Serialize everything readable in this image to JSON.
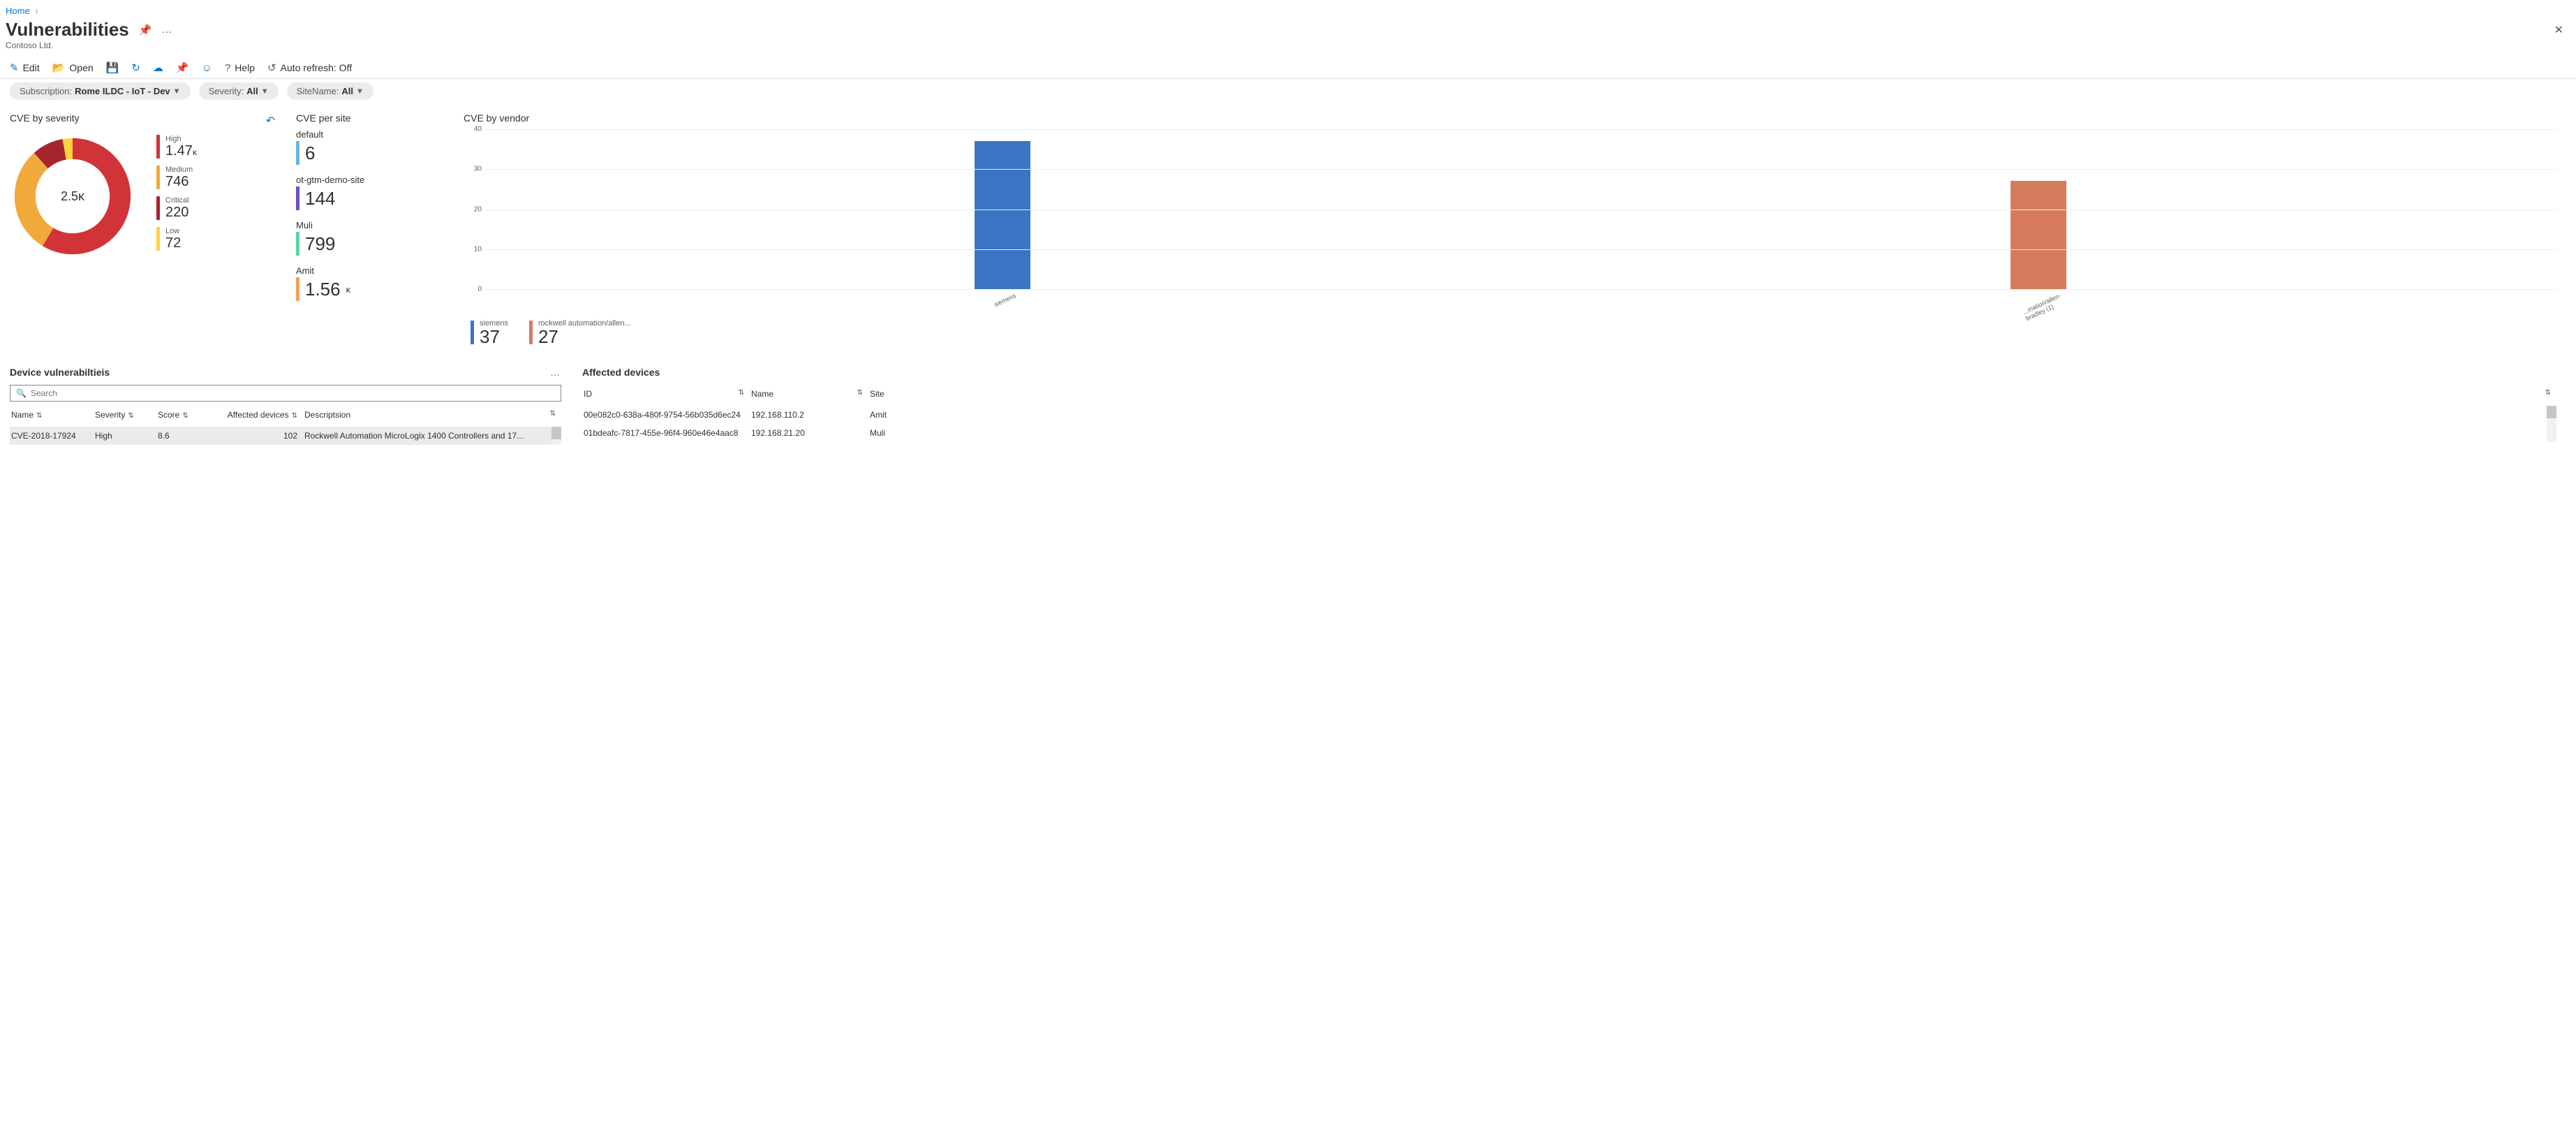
{
  "breadcrumb": {
    "home": "Home"
  },
  "page": {
    "title": "Vulnerabilities",
    "tenant": "Contoso Ltd."
  },
  "toolbar": {
    "edit": "Edit",
    "open": "Open",
    "help": "Help",
    "auto_refresh": "Auto refresh: Off"
  },
  "filters": {
    "sub_lbl": "Subscription: ",
    "sub_val": "Rome ILDC - IoT - Dev",
    "sev_lbl": "Severity: ",
    "sev_val": "All",
    "site_lbl": "SiteName: ",
    "site_val": "All"
  },
  "sev_panel": {
    "title": "CVE by severity",
    "center": "2.5ᴋ",
    "items": [
      {
        "label": "High",
        "value": "1.47",
        "suffix": "ᴋ",
        "color": "#d13438"
      },
      {
        "label": "Medium",
        "value": "746",
        "suffix": "",
        "color": "#f2a93b"
      },
      {
        "label": "Critical",
        "value": "220",
        "suffix": "",
        "color": "#a4262c"
      },
      {
        "label": "Low",
        "value": "72",
        "suffix": "",
        "color": "#ffd23f"
      }
    ]
  },
  "site_panel": {
    "title": "CVE per site",
    "items": [
      {
        "name": "default",
        "value": "6",
        "suffix": "",
        "color": "#69b3e7"
      },
      {
        "name": "ot-gtm-demo-site",
        "value": "144",
        "suffix": "",
        "color": "#6b4fbb"
      },
      {
        "name": "Muli",
        "value": "799",
        "suffix": "",
        "color": "#5dd39e"
      },
      {
        "name": "Amit",
        "value": "1.56",
        "suffix": "ᴋ",
        "color": "#f0a15e"
      }
    ]
  },
  "vendor_panel": {
    "title": "CVE by vendor",
    "legend": [
      {
        "name": "siemens",
        "value": "37",
        "color": "#3a75c4"
      },
      {
        "name": "rockwell automation/allen...",
        "value": "27",
        "color": "#d67b5c"
      }
    ],
    "xlabels": [
      "siemens",
      "...mation/allen-bradley (1)"
    ]
  },
  "chart_data": {
    "type": "bar",
    "title": "CVE by vendor",
    "categories": [
      "siemens",
      "rockwell automation/allen-bradley"
    ],
    "values": [
      37,
      27
    ],
    "xlabel": "",
    "ylabel": "",
    "ylim": [
      0,
      40
    ],
    "yticks": [
      0,
      10,
      20,
      30,
      40
    ],
    "colors": [
      "#3a75c4",
      "#d67b5c"
    ]
  },
  "vuln_panel": {
    "title": "Device vulnerabiltieis",
    "search_ph": "Search",
    "cols": {
      "name": "Name",
      "severity": "Severity",
      "score": "Score",
      "affected": "Affected devices",
      "desc": "Descriptsion"
    },
    "rows": [
      {
        "name": "CVE-2018-17924",
        "severity": "High",
        "score": "8.6",
        "affected": "102",
        "desc": "Rockwell Automation MicroLogix 1400 Controllers and 17..."
      }
    ]
  },
  "aff_panel": {
    "title": "Affected devices",
    "cols": {
      "id": "ID",
      "name": "Name",
      "site": "Site"
    },
    "rows": [
      {
        "id": "00e082c0-638a-480f-9754-56b035d6ec24",
        "name": "192.168.110.2",
        "site": "Amit"
      },
      {
        "id": "01bdeafc-7817-455e-96f4-960e46e4aac8",
        "name": "192.168.21.20",
        "site": "Muli"
      }
    ]
  }
}
